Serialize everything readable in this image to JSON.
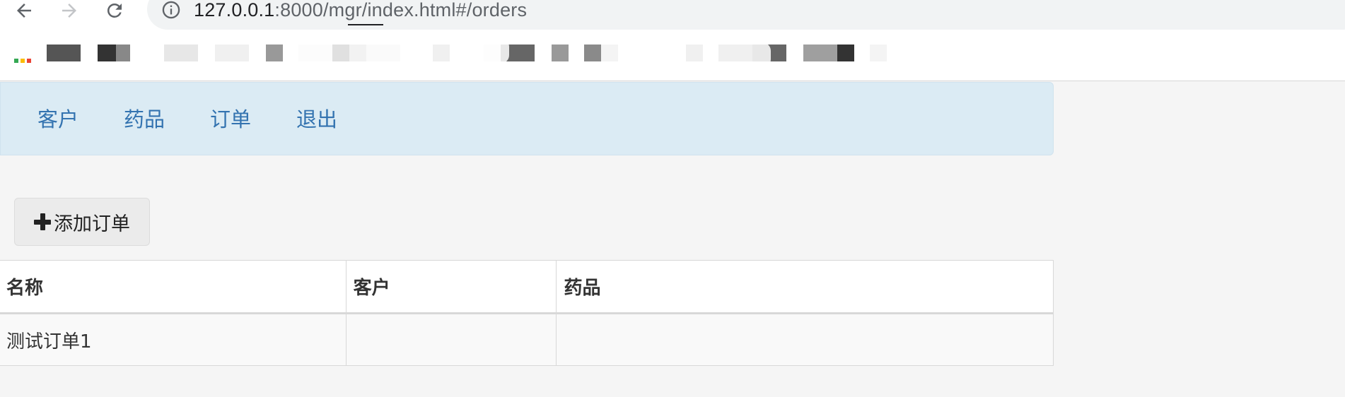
{
  "browser": {
    "url_host": "127.0.0.1",
    "url_rest": ":8000/mgr/index.html#/orders"
  },
  "navbar": {
    "links": [
      {
        "label": "客户"
      },
      {
        "label": "药品"
      },
      {
        "label": "订单"
      },
      {
        "label": "退出"
      }
    ]
  },
  "toolbar": {
    "add_order_label": "添加订单"
  },
  "orders_table": {
    "columns": [
      "名称",
      "客户",
      "药品"
    ],
    "rows": [
      [
        "测试订单1",
        "",
        ""
      ]
    ]
  },
  "colors": {
    "navbar_bg": "#dbebf4",
    "link": "#3373b0",
    "button_bg": "#ebebeb",
    "page_bg": "#f5f5f5"
  }
}
